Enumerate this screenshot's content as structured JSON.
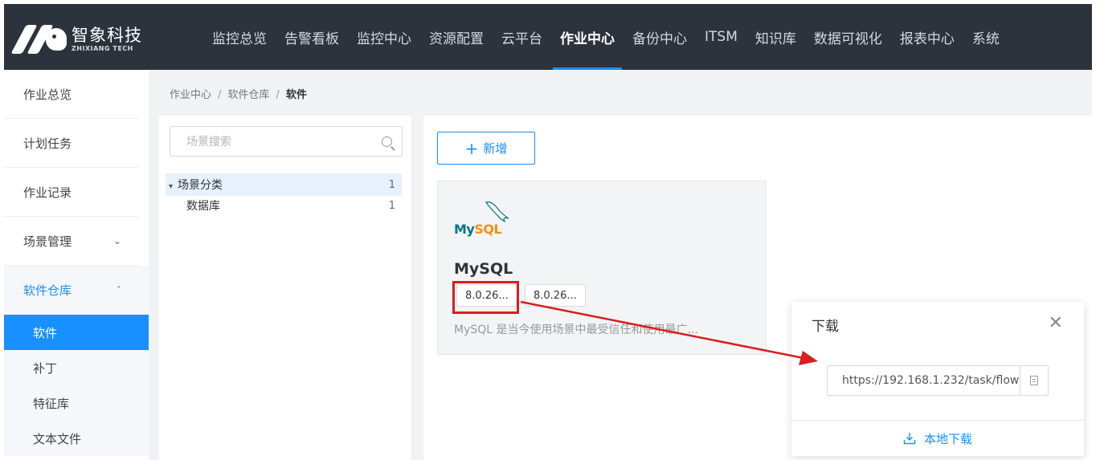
{
  "brand": {
    "name_cn": "智象科技",
    "name_en": "ZHIXIANG TECH"
  },
  "nav": [
    "监控总览",
    "告警看板",
    "监控中心",
    "资源配置",
    "云平台",
    "作业中心",
    "备份中心",
    "ITSM",
    "知识库",
    "数据可视化",
    "报表中心",
    "系统"
  ],
  "sidebar": {
    "items": [
      "作业总览",
      "计划任务",
      "作业记录",
      "场景管理"
    ],
    "group_label": "软件仓库",
    "sub_items": [
      "软件",
      "补丁",
      "特征库",
      "文本文件"
    ]
  },
  "breadcrumb": {
    "l1": "作业中心",
    "l2": "软件仓库",
    "current": "软件",
    "sep": "/"
  },
  "tree": {
    "search_placeholder": "场景搜索",
    "root_label": "场景分类",
    "root_count": "1",
    "child_label": "数据库",
    "child_count": "1"
  },
  "toolbar": {
    "add_label": "新增"
  },
  "card": {
    "logo_word_a": "My",
    "logo_word_b": "SQL",
    "title": "MySQL",
    "version_1": "8.0.26...",
    "version_2": "8.0.26...",
    "description": "MySQL 是当今使用场景中最受信任和使用最广..."
  },
  "download": {
    "title": "下载",
    "url": "https://192.168.1.232/task/flow",
    "local_label": "本地下载"
  },
  "colors": {
    "accent": "#1890ff",
    "topbar": "#2c333c",
    "annotation": "#d81e1e"
  }
}
